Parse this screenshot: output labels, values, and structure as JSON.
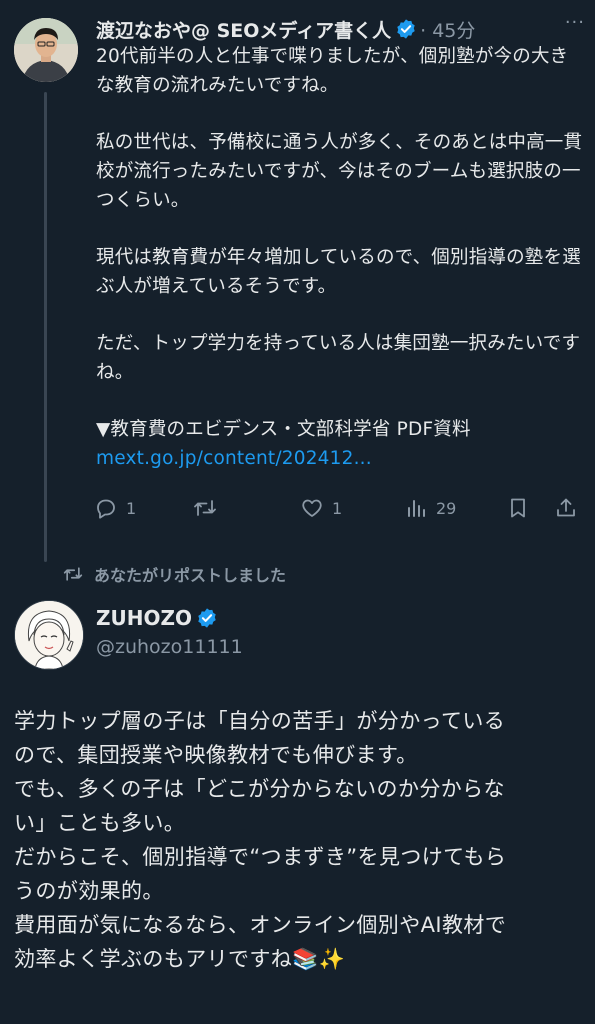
{
  "tweet1": {
    "author_name": "渡辺なおや@ SEOメディア書く人",
    "time": "· 45分",
    "more": "···",
    "paragraphs": [
      "20代前半の人と仕事で喋りましたが、個別塾が今の大きな教育の流れみたいですね。",
      "私の世代は、予備校に通う人が多く、そのあとは中高一貫校が流行ったみたいですが、今はそのブームも選択肢の一つくらい。",
      "現代は教育費が年々増加しているので、個別指導の塾を選ぶ人が増えているそうです。",
      "ただ、トップ学力を持っている人は集団塾一択みたいですね。"
    ],
    "source_label": "▼教育費のエビデンス・文部科学省 PDF資料",
    "link_text": "mext.go.jp/content/202412...",
    "actions": {
      "reply_count": "1",
      "like_count": "1",
      "views_count": "29"
    }
  },
  "repost_note": "あなたがリポストしました",
  "tweet2": {
    "author_name": "ZUHOZO",
    "handle": "@zuhozo11111",
    "lines": [
      "学力トップ層の子は「自分の苦手」が分かっている",
      "ので、集団授業や映像教材でも伸びます。",
      "でも、多くの子は「どこが分からないのか分からな",
      "い」ことも多い。",
      "だからこそ、個別指導で“つまずき”を見つけてもら",
      "うのが効果的。",
      "費用面が気になるなら、オンライン個別やAI教材で",
      "効率よく学ぶのもアリですね📚✨"
    ]
  },
  "colors": {
    "background": "#15202b",
    "text": "#e7e9ea",
    "muted": "#8b98a5",
    "accent": "#1d9bf0"
  },
  "icons": [
    "reply-icon",
    "retweet-icon",
    "like-icon",
    "views-icon",
    "bookmark-icon",
    "share-icon",
    "verified-badge-icon",
    "repost-icon"
  ]
}
